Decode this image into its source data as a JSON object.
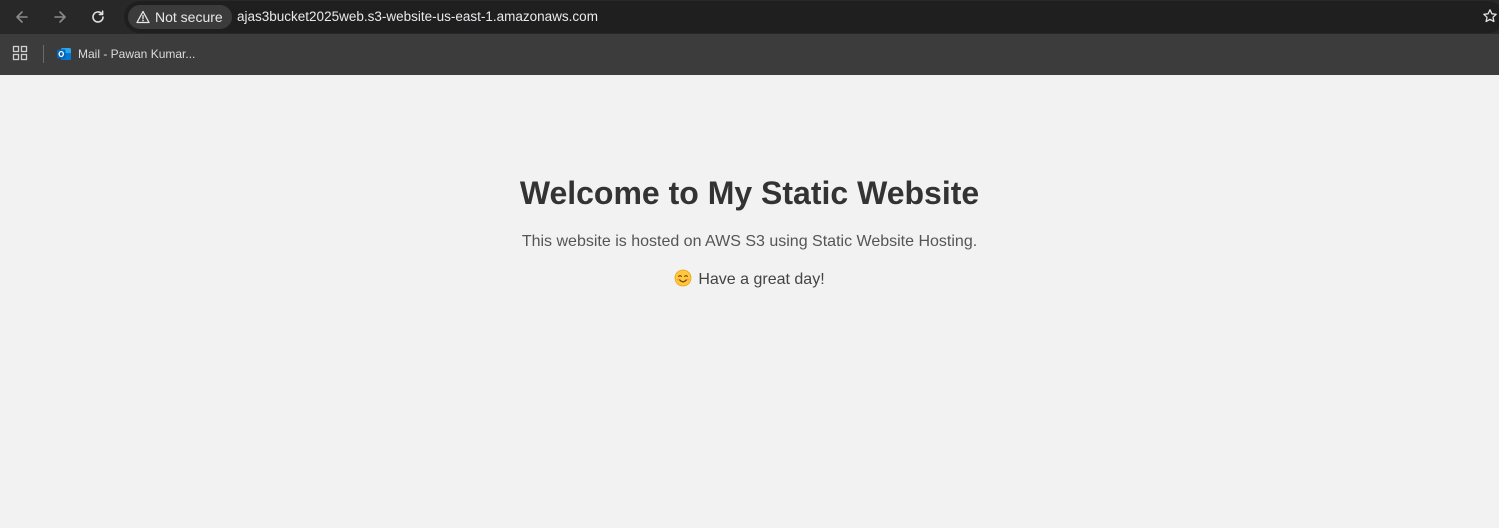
{
  "browser": {
    "security_label": "Not secure",
    "url": "ajas3bucket2025web.s3-website-us-east-1.amazonaws.com",
    "icons": {
      "back": "back-arrow-icon",
      "forward": "forward-arrow-icon",
      "reload": "reload-icon",
      "security": "warning-triangle-icon",
      "bookmark_star": "star-icon",
      "apps": "apps-grid-icon"
    },
    "colors": {
      "toolbar": "#282828",
      "omnibox": "#1f1f1f",
      "bookmarks_bar": "#3c3c3c"
    }
  },
  "bookmarks_bar": {
    "items": [
      {
        "label": "Mail - Pawan Kumar...",
        "icon": "outlook-icon"
      }
    ]
  },
  "page": {
    "heading": "Welcome to My Static Website",
    "description": "This website is hosted on AWS S3 using Static Website Hosting.",
    "greeting": "Have a great day!",
    "greeting_icon": "smiling-face-emoji-icon",
    "colors": {
      "background": "#f2f2f2",
      "heading": "#333333",
      "text": "#555555"
    }
  }
}
